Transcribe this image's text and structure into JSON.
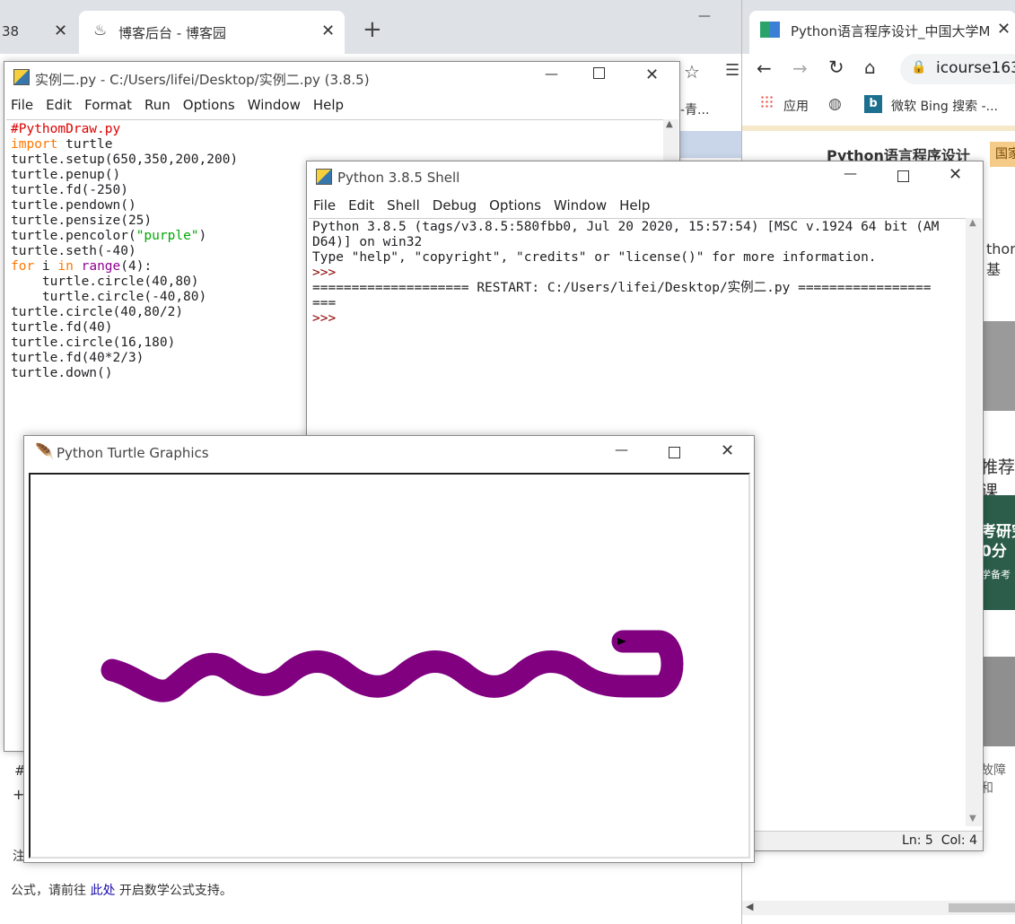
{
  "browser_left": {
    "tabs": [
      {
        "label": "38"
      },
      {
        "label": "博客后台 - 博客园"
      }
    ],
    "new_tab": "+",
    "minimize": "—",
    "bookmark_fragment": "-青...",
    "footer_hint_1": "#",
    "footer_hint_2": "+",
    "footer_note": "注",
    "footer_formula_prefix": "公式，请前往 ",
    "footer_formula_link": "此处",
    "footer_formula_suffix": " 开启数学公式支持。"
  },
  "browser_right": {
    "tab_title": "Python语言程序设计_中国大学M",
    "address": "icourse163",
    "bookmarks": [
      {
        "label": "应用"
      },
      {
        "label": "微软 Bing 搜索 -..."
      }
    ],
    "page_title": "Python语言程序设计",
    "badge": "国家",
    "side_text_1": "thon基",
    "side_text_2": "推荐课",
    "promo_line1": "考研究",
    "promo_line2": "0分",
    "promo_line3": "学备考",
    "fault_text": "故障和"
  },
  "idle_editor": {
    "title": "实例二.py - C:/Users/lifei/Desktop/实例二.py (3.8.5)",
    "menu": [
      "File",
      "Edit",
      "Format",
      "Run",
      "Options",
      "Window",
      "Help"
    ],
    "code": [
      {
        "t": "#PythomDraw.py",
        "c": "cmt"
      },
      {
        "t": "import turtle",
        "c": "imp"
      },
      {
        "t": "turtle.setup(650,350,200,200)",
        "c": ""
      },
      {
        "t": "turtle.penup()",
        "c": ""
      },
      {
        "t": "turtle.fd(-250)",
        "c": ""
      },
      {
        "t": "turtle.pendown()",
        "c": ""
      },
      {
        "t": "turtle.pensize(25)",
        "c": ""
      },
      {
        "t": "turtle.pencolor(\"purple\")",
        "c": "str"
      },
      {
        "t": "turtle.seth(-40)",
        "c": ""
      },
      {
        "t": "for i in range(4):",
        "c": "for"
      },
      {
        "t": "    turtle.circle(40,80)",
        "c": ""
      },
      {
        "t": "    turtle.circle(-40,80)",
        "c": ""
      },
      {
        "t": "turtle.circle(40,80/2)",
        "c": ""
      },
      {
        "t": "turtle.fd(40)",
        "c": ""
      },
      {
        "t": "turtle.circle(16,180)",
        "c": ""
      },
      {
        "t": "turtle.fd(40*2/3)",
        "c": ""
      },
      {
        "t": "turtle.down()",
        "c": ""
      }
    ]
  },
  "idle_shell": {
    "title": "Python 3.8.5 Shell",
    "menu": [
      "File",
      "Edit",
      "Shell",
      "Debug",
      "Options",
      "Window",
      "Help"
    ],
    "lines": [
      "Python 3.8.5 (tags/v3.8.5:580fbb0, Jul 20 2020, 15:57:54) [MSC v.1924 64 bit (AM",
      "D64)] on win32",
      "Type \"help\", \"copyright\", \"credits\" or \"license()\" for more information.",
      ">>> ",
      "==================== RESTART: C:/Users/lifei/Desktop/实例二.py =================",
      "===",
      ">>> "
    ],
    "status": "Ln: 5  Col: 4"
  },
  "turtle_window": {
    "title": "Python Turtle Graphics",
    "pen_color": "#800080"
  },
  "colors": {
    "editor_keyword": "#ff7700",
    "editor_builtin": "#900090",
    "editor_string": "#00aa00",
    "editor_comment": "#dd0000",
    "shell_prompt": "#8b0000",
    "snake": "#800080"
  }
}
